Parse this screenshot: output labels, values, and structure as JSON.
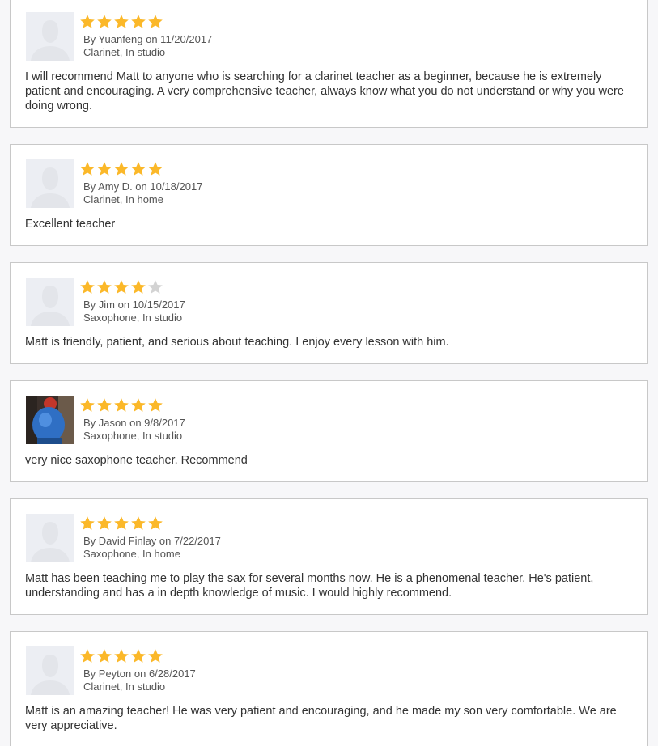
{
  "colors": {
    "star_filled": "#fbb829",
    "star_empty": "#d3d3d3",
    "avatar_placeholder": "#eceef3",
    "card_border": "#c8c8c8"
  },
  "reviews": [
    {
      "avatar": "default-avatar-icon",
      "rating": 5,
      "byline": "By Yuanfeng on 11/20/2017",
      "lesson": "Clarinet, In studio",
      "text": "I will recommend Matt to anyone who is searching for a clarinet teacher as a beginner, because he is extremely patient and encouraging. A very comprehensive teacher, always know what you do not understand or why you were doing wrong."
    },
    {
      "avatar": "default-avatar-icon",
      "rating": 5,
      "byline": "By Amy D. on 10/18/2017",
      "lesson": "Clarinet, In home",
      "text": "Excellent teacher"
    },
    {
      "avatar": "default-avatar-icon",
      "rating": 4,
      "byline": "By Jim on 10/15/2017",
      "lesson": "Saxophone, In studio",
      "text": "Matt is friendly, patient, and serious about teaching. I enjoy every lesson with him."
    },
    {
      "avatar": "user-photo",
      "rating": 5,
      "byline": "By Jason on 9/8/2017",
      "lesson": "Saxophone, In studio",
      "text": "very nice saxophone teacher. Recommend"
    },
    {
      "avatar": "default-avatar-icon",
      "rating": 5,
      "byline": "By David Finlay on 7/22/2017",
      "lesson": "Saxophone, In home",
      "text": "Matt has been teaching me to play the sax for several months now. He is a phenomenal teacher. He's patient, understanding and has a in depth knowledge of music. I would highly recommend."
    },
    {
      "avatar": "default-avatar-icon",
      "rating": 5,
      "byline": "By Peyton on 6/28/2017",
      "lesson": "Clarinet, In studio",
      "text": "Matt is an amazing teacher! He was very patient and encouraging, and he made my son very comfortable. We are very appreciative."
    }
  ]
}
